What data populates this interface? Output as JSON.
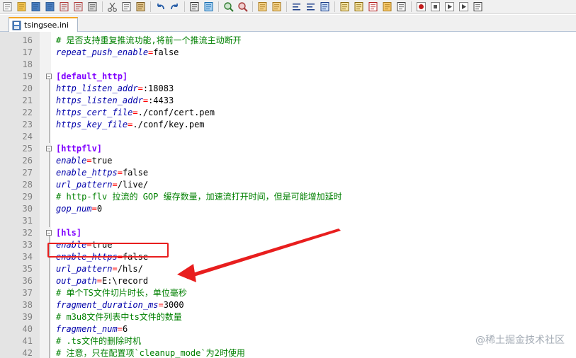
{
  "toolbar": {
    "buttons": [
      "new-file-icon",
      "open-file-icon",
      "save-icon",
      "save-all-icon",
      "close-icon",
      "close-all-icon",
      "print-icon",
      "cut-icon",
      "copy-icon",
      "paste-icon",
      "undo-icon",
      "redo-icon",
      "find-icon",
      "replace-icon",
      "zoom-in-icon",
      "zoom-out-icon",
      "sync-vertical-icon",
      "sync-horizontal-icon",
      "word-wrap-icon",
      "show-all-chars-icon",
      "indent-guide-icon",
      "udl-icon",
      "doc-map-icon",
      "function-list-icon",
      "folder-workspace-icon",
      "monitoring-icon",
      "record-macro-icon",
      "stop-record-icon",
      "playback-icon",
      "run-multiple-icon",
      "save-macro-icon"
    ]
  },
  "tab": {
    "label": "tsingsee.ini"
  },
  "editor": {
    "lines": [
      {
        "n": "16",
        "type": "comment",
        "text": "# 是否支持重复推流功能,将前一个推流主动断开"
      },
      {
        "n": "17",
        "type": "kv",
        "key": "repeat_push_enable",
        "value": "false"
      },
      {
        "n": "18",
        "type": "blank"
      },
      {
        "n": "19",
        "type": "section",
        "text": "[default_http]"
      },
      {
        "n": "20",
        "type": "kv",
        "key": "http_listen_addr",
        "value": ":18083"
      },
      {
        "n": "21",
        "type": "kv",
        "key": "https_listen_addr",
        "value": ":4433"
      },
      {
        "n": "22",
        "type": "kv",
        "key": "https_cert_file",
        "value": "./conf/cert.pem"
      },
      {
        "n": "23",
        "type": "kv",
        "key": "https_key_file",
        "value": "./conf/key.pem"
      },
      {
        "n": "24",
        "type": "blank"
      },
      {
        "n": "25",
        "type": "section",
        "text": "[httpflv]"
      },
      {
        "n": "26",
        "type": "kv",
        "key": "enable",
        "value": "true"
      },
      {
        "n": "27",
        "type": "kv",
        "key": "enable_https",
        "value": "false"
      },
      {
        "n": "28",
        "type": "kv",
        "key": "url_pattern",
        "value": "/live/"
      },
      {
        "n": "29",
        "type": "comment",
        "text": "# http-flv 拉流的 GOP 缓存数量，加速流打开时间，但是可能增加延时"
      },
      {
        "n": "30",
        "type": "kv",
        "key": "gop_num",
        "value": "0"
      },
      {
        "n": "31",
        "type": "blank"
      },
      {
        "n": "32",
        "type": "section",
        "text": "[hls]"
      },
      {
        "n": "33",
        "type": "kv",
        "key": "enable",
        "value": "true"
      },
      {
        "n": "34",
        "type": "kv",
        "key": "enable_https",
        "value": "false"
      },
      {
        "n": "35",
        "type": "kv",
        "key": "url_pattern",
        "value": "/hls/"
      },
      {
        "n": "36",
        "type": "kv",
        "key": "out_path",
        "value": "E:\\record"
      },
      {
        "n": "37",
        "type": "comment",
        "text": "# 单个TS文件切片时长，单位毫秒"
      },
      {
        "n": "38",
        "type": "kv",
        "key": "fragment_duration_ms",
        "value": "3000"
      },
      {
        "n": "39",
        "type": "comment",
        "text": "# m3u8文件列表中ts文件的数量"
      },
      {
        "n": "40",
        "type": "kv",
        "key": "fragment_num",
        "value": "6"
      },
      {
        "n": "41",
        "type": "comment",
        "text": "# .ts文件的删除时机"
      },
      {
        "n": "42",
        "type": "comment",
        "text": "# 注意，只在配置项`cleanup_mode`为2时使用"
      }
    ]
  },
  "colors": {
    "key": "#0000aa",
    "equals": "#ff0000",
    "section": "#8000ff",
    "comment": "#008000",
    "annotation": "#e81e1e"
  },
  "watermark": "@稀土掘金技术社区"
}
